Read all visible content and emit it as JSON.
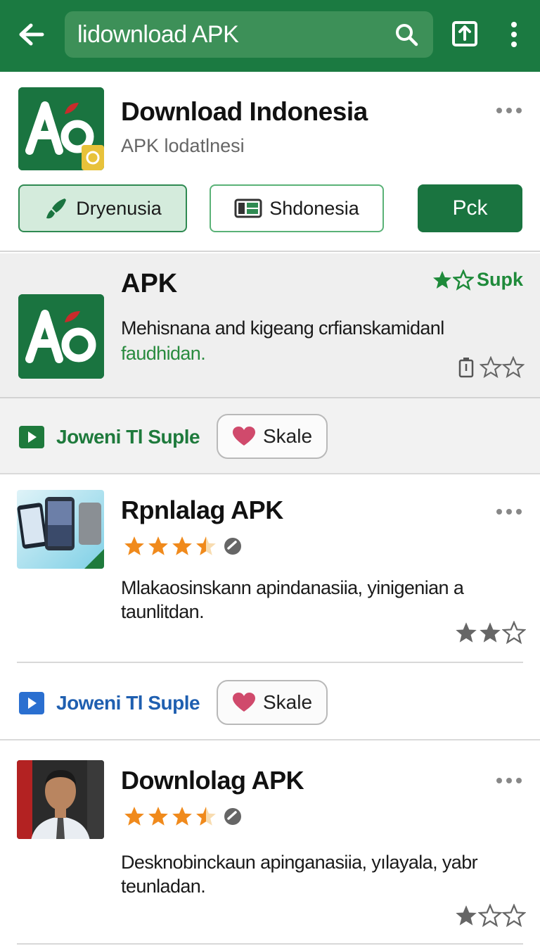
{
  "topbar": {
    "search_value": "lidownload APK",
    "icons": [
      "back-arrow-icon",
      "search-icon",
      "save-icon",
      "more-vertical-icon"
    ],
    "color": "#1b7a41"
  },
  "app_header": {
    "title": "Download Indonesia",
    "subtitle": "APK lodatlnesi",
    "icon": "apk-logo-icon",
    "chips": [
      {
        "label": "Dryenusia",
        "icon": "brush-icon"
      },
      {
        "label": "Shdonesia",
        "icon": "panel-icon"
      },
      {
        "label": "Pck"
      }
    ]
  },
  "featured": {
    "title": "APK",
    "badge": "Supk",
    "desc_main": "Mehisnana and kigeang crfianskamidanl",
    "desc_link": "faudhidan.",
    "rating": {
      "stars": 0,
      "max": 2
    }
  },
  "actions": [
    {
      "link_label": "Joweni Tl Suple",
      "button_label": "Skale",
      "link_color": "#1e7a3c",
      "play_color": "#1e7a3c"
    },
    {
      "link_label": "Joweni Tl Suple",
      "button_label": "Skale",
      "link_color": "#1f5fb0",
      "play_color": "#2a6fd0"
    }
  ],
  "list": [
    {
      "title": "Rpnlalag APK",
      "rating": 3.5,
      "description": "Mlakaosinskann apindanasiia, yinigenian a taunlitdan.",
      "mini_rating": {
        "stars": 2,
        "max": 3
      }
    },
    {
      "title": "Downlolag APK",
      "rating": 3.5,
      "description": "Desknobinckaun apinganasiia, yılayala, yabr teunladan.",
      "mini_rating": {
        "stars": 1,
        "max": 3
      }
    }
  ],
  "colors": {
    "green": "#1a7440",
    "star": "#f08a1c",
    "heart": "#d04a6c"
  }
}
